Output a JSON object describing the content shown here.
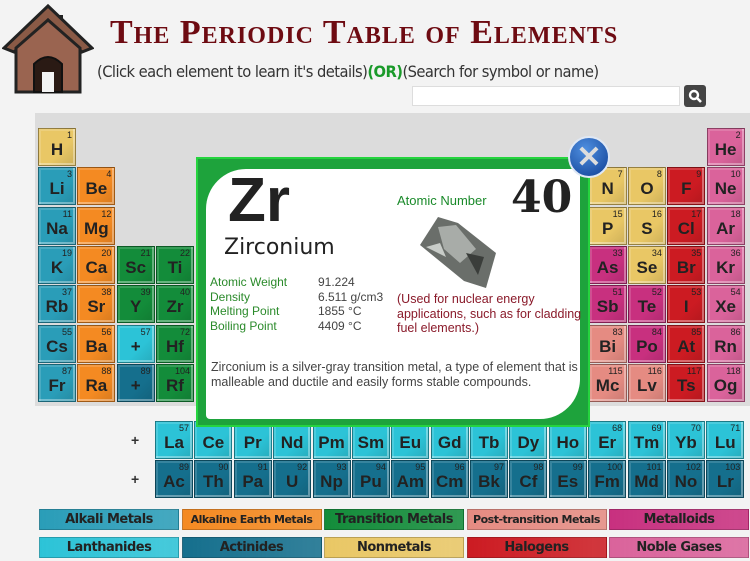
{
  "header": {
    "title": "The Periodic Table of Elements",
    "subtitle_left": "(Click each element to learn it's details)",
    "subtitle_or": "(OR)",
    "subtitle_right": "(Search for symbol or name)",
    "search_placeholder": "",
    "search_icon": "magnifier-icon",
    "home_icon": "house-icon"
  },
  "colors": {
    "alkali": "#2a9db8",
    "alkaline": "#f48a22",
    "transition": "#138c3a",
    "post": "#e58b82",
    "metalloid": "#c8307f",
    "lanthanide": "#2cc3d7",
    "actinide": "#156f8d",
    "nonmetal": "#e9c765",
    "halogen": "#cc1b22",
    "noble": "#da639b"
  },
  "elements": [
    {
      "sym": "H",
      "num": "1",
      "cat": "nonmetal",
      "group": 1,
      "period": 1
    },
    {
      "sym": "Li",
      "num": "3",
      "cat": "alkali",
      "group": 1,
      "period": 2
    },
    {
      "sym": "Na",
      "num": "11",
      "cat": "alkali",
      "group": 1,
      "period": 3
    },
    {
      "sym": "K",
      "num": "19",
      "cat": "alkali",
      "group": 1,
      "period": 4
    },
    {
      "sym": "Rb",
      "num": "37",
      "cat": "alkali",
      "group": 1,
      "period": 5
    },
    {
      "sym": "Cs",
      "num": "55",
      "cat": "alkali",
      "group": 1,
      "period": 6
    },
    {
      "sym": "Fr",
      "num": "87",
      "cat": "alkali",
      "group": 1,
      "period": 7
    },
    {
      "sym": "Be",
      "num": "4",
      "cat": "alkaline",
      "group": 2,
      "period": 2
    },
    {
      "sym": "Mg",
      "num": "12",
      "cat": "alkaline",
      "group": 2,
      "period": 3
    },
    {
      "sym": "Ca",
      "num": "20",
      "cat": "alkaline",
      "group": 2,
      "period": 4
    },
    {
      "sym": "Sr",
      "num": "38",
      "cat": "alkaline",
      "group": 2,
      "period": 5
    },
    {
      "sym": "Ba",
      "num": "56",
      "cat": "alkaline",
      "group": 2,
      "period": 6
    },
    {
      "sym": "Ra",
      "num": "88",
      "cat": "alkaline",
      "group": 2,
      "period": 7
    },
    {
      "sym": "Sc",
      "num": "21",
      "cat": "transition",
      "group": 3,
      "period": 4
    },
    {
      "sym": "Y",
      "num": "39",
      "cat": "transition",
      "group": 3,
      "period": 5
    },
    {
      "sym": "+",
      "num": "57",
      "cat": "lanthanide",
      "group": 3,
      "period": 6
    },
    {
      "sym": "+",
      "num": "89",
      "cat": "actinide",
      "group": 3,
      "period": 7
    },
    {
      "sym": "Ti",
      "num": "22",
      "cat": "transition",
      "group": 4,
      "period": 4
    },
    {
      "sym": "Zr",
      "num": "40",
      "cat": "transition",
      "group": 4,
      "period": 5
    },
    {
      "sym": "Hf",
      "num": "72",
      "cat": "transition",
      "group": 4,
      "period": 6
    },
    {
      "sym": "Rf",
      "num": "104",
      "cat": "transition",
      "group": 4,
      "period": 7
    },
    {
      "sym": "N",
      "num": "7",
      "cat": "nonmetal",
      "group": 15,
      "period": 2
    },
    {
      "sym": "P",
      "num": "15",
      "cat": "nonmetal",
      "group": 15,
      "period": 3
    },
    {
      "sym": "As",
      "num": "33",
      "cat": "metalloid",
      "group": 15,
      "period": 4
    },
    {
      "sym": "Sb",
      "num": "51",
      "cat": "metalloid",
      "group": 15,
      "period": 5
    },
    {
      "sym": "Bi",
      "num": "83",
      "cat": "post",
      "group": 15,
      "period": 6
    },
    {
      "sym": "Mc",
      "num": "115",
      "cat": "post",
      "group": 15,
      "period": 7
    },
    {
      "sym": "O",
      "num": "8",
      "cat": "nonmetal",
      "group": 16,
      "period": 2
    },
    {
      "sym": "S",
      "num": "16",
      "cat": "nonmetal",
      "group": 16,
      "period": 3
    },
    {
      "sym": "Se",
      "num": "34",
      "cat": "nonmetal",
      "group": 16,
      "period": 4
    },
    {
      "sym": "Te",
      "num": "52",
      "cat": "metalloid",
      "group": 16,
      "period": 5
    },
    {
      "sym": "Po",
      "num": "84",
      "cat": "metalloid",
      "group": 16,
      "period": 6
    },
    {
      "sym": "Lv",
      "num": "116",
      "cat": "post",
      "group": 16,
      "period": 7
    },
    {
      "sym": "F",
      "num": "9",
      "cat": "halogen",
      "group": 17,
      "period": 2
    },
    {
      "sym": "Cl",
      "num": "17",
      "cat": "halogen",
      "group": 17,
      "period": 3
    },
    {
      "sym": "Br",
      "num": "35",
      "cat": "halogen",
      "group": 17,
      "period": 4
    },
    {
      "sym": "I",
      "num": "53",
      "cat": "halogen",
      "group": 17,
      "period": 5
    },
    {
      "sym": "At",
      "num": "85",
      "cat": "halogen",
      "group": 17,
      "period": 6
    },
    {
      "sym": "Ts",
      "num": "117",
      "cat": "halogen",
      "group": 17,
      "period": 7
    },
    {
      "sym": "He",
      "num": "2",
      "cat": "noble",
      "group": 18,
      "period": 1
    },
    {
      "sym": "Ne",
      "num": "10",
      "cat": "noble",
      "group": 18,
      "period": 2
    },
    {
      "sym": "Ar",
      "num": "18",
      "cat": "noble",
      "group": 18,
      "period": 3
    },
    {
      "sym": "Kr",
      "num": "36",
      "cat": "noble",
      "group": 18,
      "period": 4
    },
    {
      "sym": "Xe",
      "num": "54",
      "cat": "noble",
      "group": 18,
      "period": 5
    },
    {
      "sym": "Rn",
      "num": "86",
      "cat": "noble",
      "group": 18,
      "period": 6
    },
    {
      "sym": "Og",
      "num": "118",
      "cat": "noble",
      "group": 18,
      "period": 7
    }
  ],
  "lanthanides": {
    "marker": "+",
    "items": [
      {
        "sym": "La",
        "num": "57"
      },
      {
        "sym": "Ce",
        "num": ""
      },
      {
        "sym": "Pr",
        "num": ""
      },
      {
        "sym": "Nd",
        "num": ""
      },
      {
        "sym": "Pm",
        "num": ""
      },
      {
        "sym": "Sm",
        "num": ""
      },
      {
        "sym": "Eu",
        "num": ""
      },
      {
        "sym": "Gd",
        "num": ""
      },
      {
        "sym": "Tb",
        "num": ""
      },
      {
        "sym": "Dy",
        "num": ""
      },
      {
        "sym": "Ho",
        "num": ""
      },
      {
        "sym": "Er",
        "num": "68"
      },
      {
        "sym": "Tm",
        "num": "69"
      },
      {
        "sym": "Yb",
        "num": "70"
      },
      {
        "sym": "Lu",
        "num": "71"
      }
    ]
  },
  "actinides": {
    "marker": "+",
    "items": [
      {
        "sym": "Ac",
        "num": "89"
      },
      {
        "sym": "Th",
        "num": "90"
      },
      {
        "sym": "Pa",
        "num": "91"
      },
      {
        "sym": "U",
        "num": "92"
      },
      {
        "sym": "Np",
        "num": "93"
      },
      {
        "sym": "Pu",
        "num": "94"
      },
      {
        "sym": "Am",
        "num": "95"
      },
      {
        "sym": "Cm",
        "num": "96"
      },
      {
        "sym": "Bk",
        "num": "97"
      },
      {
        "sym": "Cf",
        "num": "98"
      },
      {
        "sym": "Es",
        "num": "99"
      },
      {
        "sym": "Fm",
        "num": "100"
      },
      {
        "sym": "Md",
        "num": "101"
      },
      {
        "sym": "No",
        "num": "102"
      },
      {
        "sym": "Lr",
        "num": "103"
      }
    ]
  },
  "popup": {
    "symbol": "Zr",
    "name": "Zirconium",
    "atomic_number_label": "Atomic Number",
    "atomic_number": "40",
    "close_icon": "close-x-icon",
    "props": [
      {
        "k": "Atomic Weight",
        "v": "91.224"
      },
      {
        "k": "Density",
        "v": "6.511 g/cm3"
      },
      {
        "k": "Melting Point",
        "v": "1855 °C"
      },
      {
        "k": "Boiling Point",
        "v": "4409 °C"
      }
    ],
    "use": "(Used for nuclear energy applications, such as for cladding fuel elements.)",
    "description": "Zirconium is a silver-gray transition metal, a type of element that is malleable and ductile and easily forms stable compounds."
  },
  "legend": [
    {
      "label": "Alkali Metals",
      "cat": "alkali"
    },
    {
      "label": "Alkaline Earth Metals",
      "cat": "alkaline"
    },
    {
      "label": "Transition Metals",
      "cat": "transition"
    },
    {
      "label": "Post-transition Metals",
      "cat": "post"
    },
    {
      "label": "Metalloids",
      "cat": "metalloid"
    },
    {
      "label": "Lanthanides",
      "cat": "lanthanide"
    },
    {
      "label": "Actinides",
      "cat": "actinide"
    },
    {
      "label": "Nonmetals",
      "cat": "nonmetal"
    },
    {
      "label": "Halogens",
      "cat": "halogen"
    },
    {
      "label": "Noble Gases",
      "cat": "noble"
    }
  ]
}
